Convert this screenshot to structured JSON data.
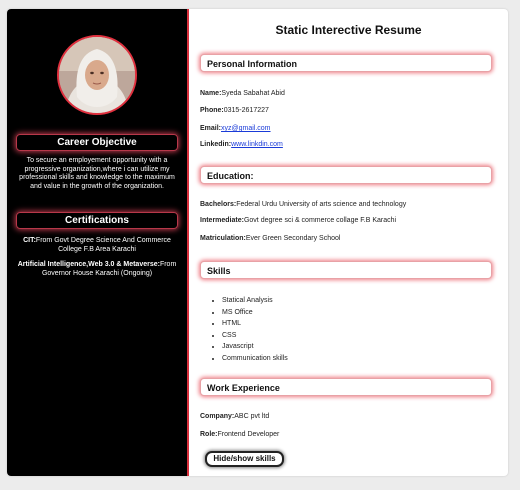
{
  "sidebar": {
    "career_objective_heading": "Career Objective",
    "career_objective_text": "To secure an employement opportunity with a progressive organization,where i can utilize my professional skills and knowledge to the maximum and value in the growth of the organization.",
    "certifications_heading": "Certifications",
    "certifications": [
      {
        "label": "CIT:",
        "text": "From Govt Degree Science And Commerce College F.B Area Karachi"
      },
      {
        "label": "Artificial Intelligence,Web 3.0 & Metaverse:",
        "text": "From Governor House Karachi (Ongoing)"
      }
    ]
  },
  "main": {
    "title": "Static Interective Resume",
    "personal": {
      "heading": "Personal Information",
      "name_label": "Name:",
      "name": "Syeda Sabahat Abid",
      "phone_label": "Phone:",
      "phone": "0315-2617227",
      "email_label": "Email:",
      "email": "xyz@gmail.com",
      "linkedin_label": "Linkedin:",
      "linkedin": "www.linkdin.com"
    },
    "education": {
      "heading": "Education:",
      "items": [
        {
          "label": "Bachelors:",
          "text": "Federal Urdu University of arts science and technology"
        },
        {
          "label": "Intermediate:",
          "text": "Govt degree sci & commerce collage F.B Karachi"
        },
        {
          "label": "Matriculation:",
          "text": "Ever Green Secondary School"
        }
      ]
    },
    "skills": {
      "heading": "Skills",
      "items": [
        "Statical Analysis",
        "MS Office",
        "HTML",
        "CSS",
        "Javascript",
        "Communication skills"
      ]
    },
    "work": {
      "heading": "Work Experience",
      "company_label": "Company:",
      "company": "ABC pvt ltd",
      "role_label": "Role:",
      "role": "Frontend Developer"
    },
    "toggle_button": "Hide/show skills"
  },
  "colors": {
    "sidebar_bg": "#000000",
    "accent": "#d9303c",
    "link": "#1a3bd8"
  }
}
